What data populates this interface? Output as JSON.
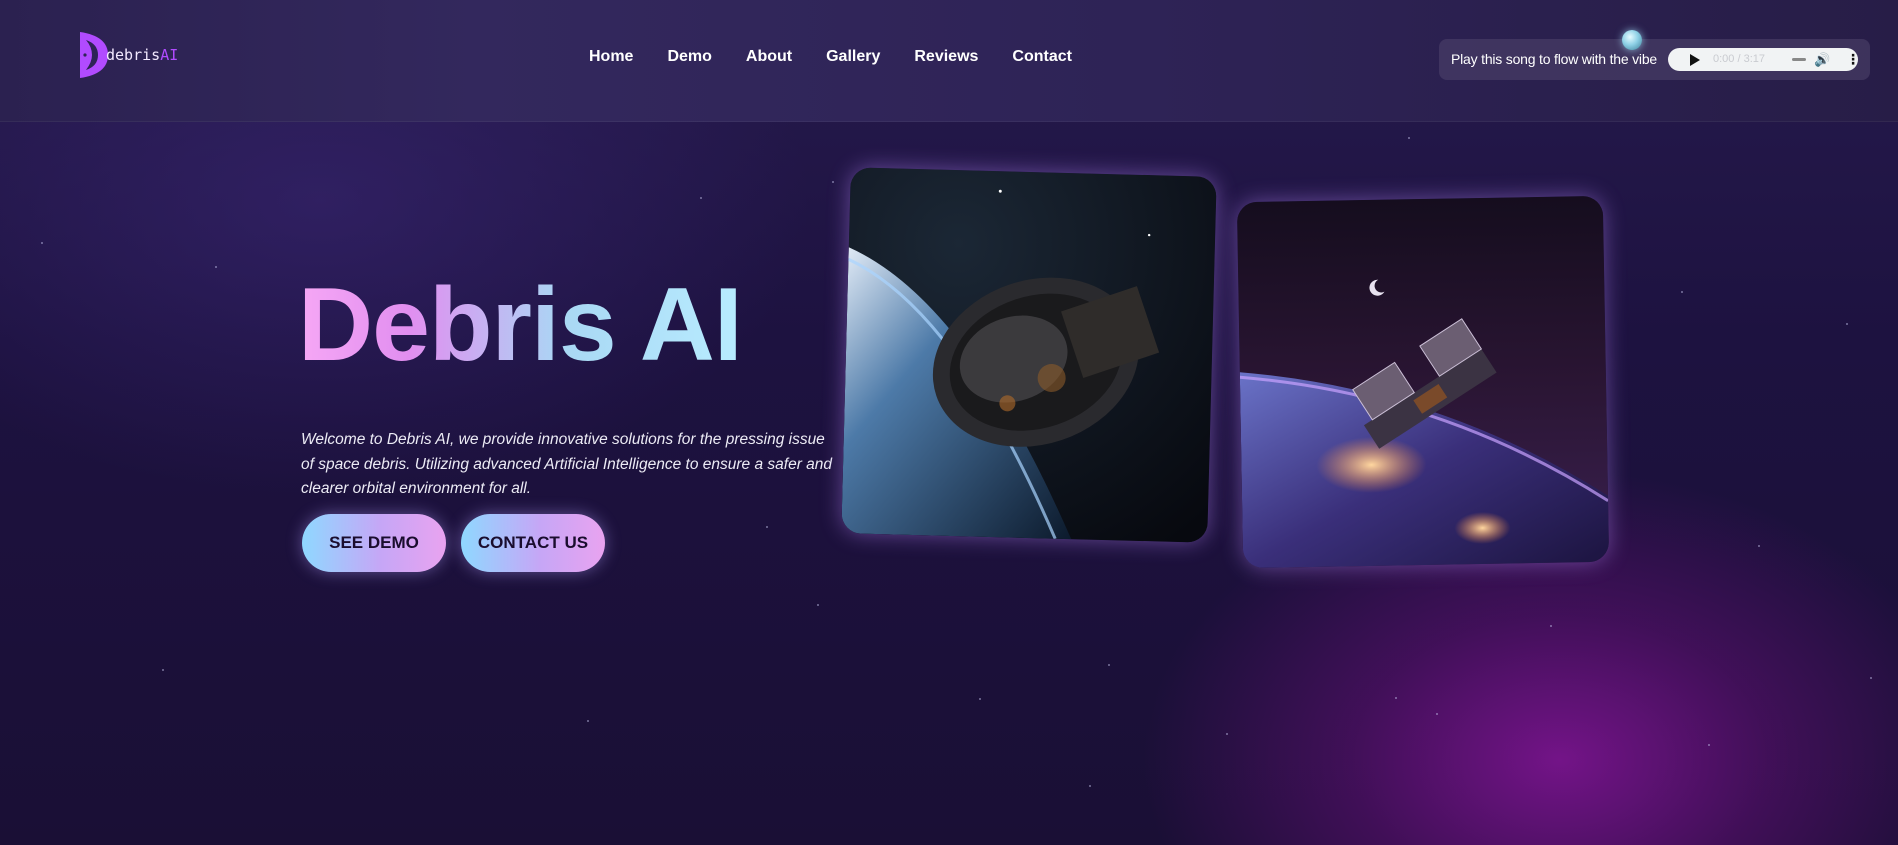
{
  "brand": {
    "logo_text": "debris",
    "logo_ai": "AI"
  },
  "nav": {
    "items": [
      {
        "label": "Home"
      },
      {
        "label": "Demo"
      },
      {
        "label": "About"
      },
      {
        "label": "Gallery"
      },
      {
        "label": "Reviews"
      },
      {
        "label": "Contact"
      }
    ]
  },
  "audio": {
    "label": "Play this song to flow with the vibe",
    "time": "0:00 / 3:17",
    "icons": [
      "play-icon",
      "volume-icon",
      "more-options-icon"
    ]
  },
  "hero": {
    "title": "Debris AI",
    "description": "Welcome to Debris AI, we provide innovative solutions for the pressing issue of space debris. Utilizing advanced Artificial Intelligence to ensure a safer and clearer orbital environment for all.",
    "buttons": {
      "demo": "SEE DEMO",
      "contact": "CONTACT US"
    }
  },
  "images": [
    {
      "name": "space-station-debris-image"
    },
    {
      "name": "satellite-over-earth-image"
    }
  ],
  "colors": {
    "accent_purple": "#b14bff",
    "title_gradient_start": "#f6a8f5",
    "title_gradient_end": "#b8ecff",
    "background": "#1d1240"
  }
}
